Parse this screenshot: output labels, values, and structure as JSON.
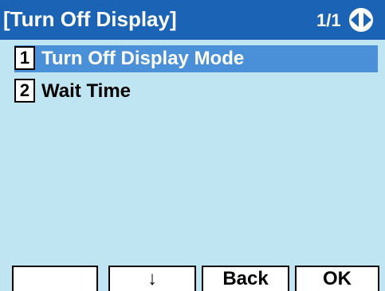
{
  "header": {
    "title": "[Turn Off Display]",
    "page_indicator": "1/1",
    "nav_icon": "left-right-arrows-icon"
  },
  "menu": {
    "items": [
      {
        "number": "1",
        "label": "Turn Off Display Mode",
        "selected": true
      },
      {
        "number": "2",
        "label": "Wait Time",
        "selected": false
      }
    ]
  },
  "softkeys": [
    "",
    "↓",
    "Back",
    "OK"
  ],
  "colors": {
    "titlebar": "#1a63b5",
    "background": "#bfe4f2",
    "selection": "#4a90d9"
  }
}
